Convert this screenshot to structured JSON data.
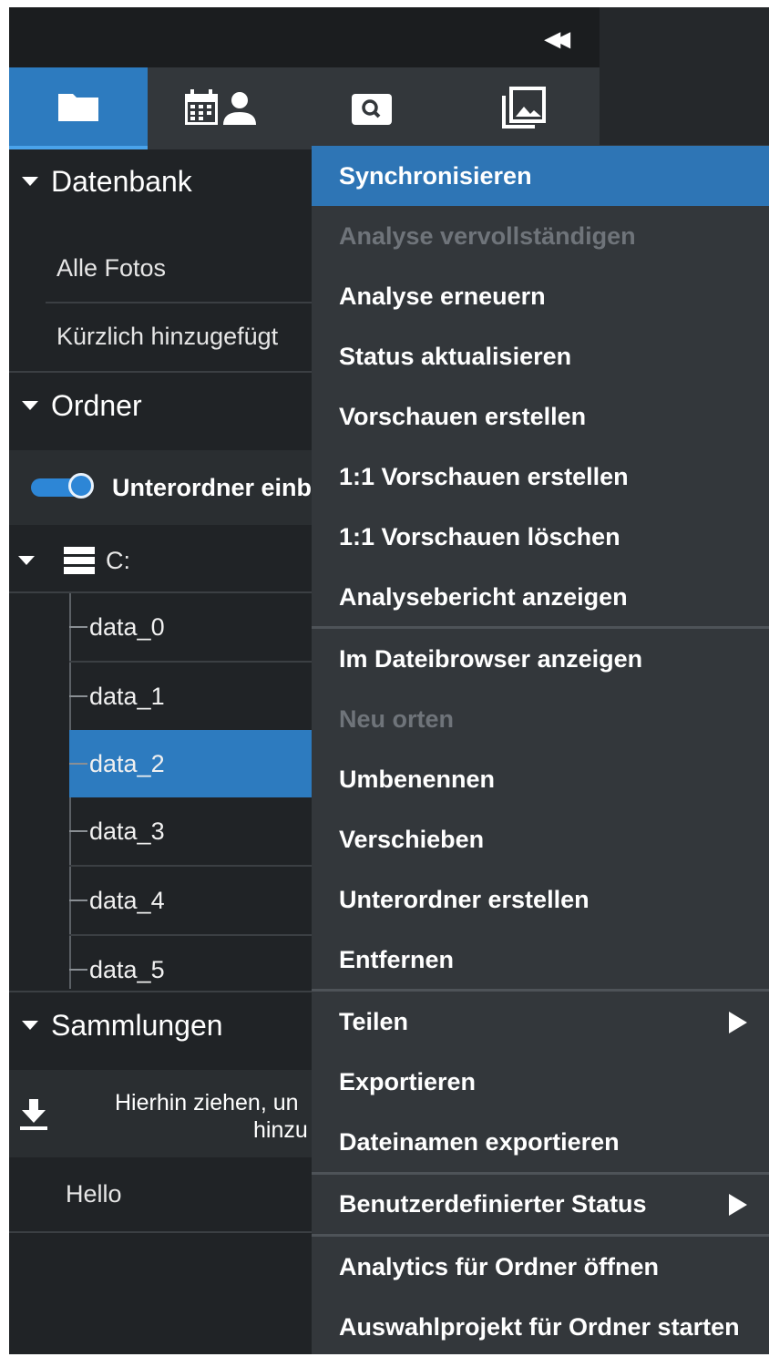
{
  "tabs": [
    {
      "name": "folder-tab",
      "icon": "folder-icon",
      "active": true
    },
    {
      "name": "calendar-person-tab",
      "icon": "calendar-person-icon",
      "active": false
    },
    {
      "name": "search-tab",
      "icon": "search-icon",
      "active": false
    },
    {
      "name": "images-tab",
      "icon": "image-stack-icon",
      "active": false
    }
  ],
  "database": {
    "title": "Datenbank",
    "items": [
      "Alle Fotos",
      "Kürzlich hinzugefügt"
    ]
  },
  "folders": {
    "title": "Ordner",
    "toggle_label": "Unterordner einb",
    "toggle_on": true,
    "drive": "C:",
    "items": [
      "data_0",
      "data_1",
      "data_2",
      "data_3",
      "data_4",
      "data_5"
    ],
    "selected": "data_2"
  },
  "collections": {
    "title": "Sammlungen",
    "drop_line1": "Hierhin ziehen, un",
    "drop_line2": "hinzu",
    "items": [
      "Hello"
    ]
  },
  "context_menu": {
    "items": [
      "Synchronisieren",
      "Analyse vervollständigen",
      "Analyse erneuern",
      "Status aktualisieren",
      "Vorschauen erstellen",
      "1:1 Vorschauen erstellen",
      "1:1 Vorschauen löschen",
      "Analysebericht anzeigen",
      "Im Dateibrowser anzeigen",
      "Neu orten",
      "Umbenennen",
      "Verschieben",
      "Unterordner erstellen",
      "Entfernen",
      "Teilen",
      "Exportieren",
      "Dateinamen exportieren",
      "Benutzerdefinierter Status",
      "Analytics für Ordner öffnen",
      "Auswahlprojekt für Ordner starten"
    ],
    "highlighted": "Synchronisieren",
    "disabled": [
      "Analyse vervollständigen",
      "Neu orten"
    ],
    "has_submenu": [
      "Teilen",
      "Benutzerdefinierter Status"
    ],
    "colors": {
      "highlight": "#2e75b5",
      "background": "#33373b",
      "disabled_text": "#6f747a"
    }
  }
}
